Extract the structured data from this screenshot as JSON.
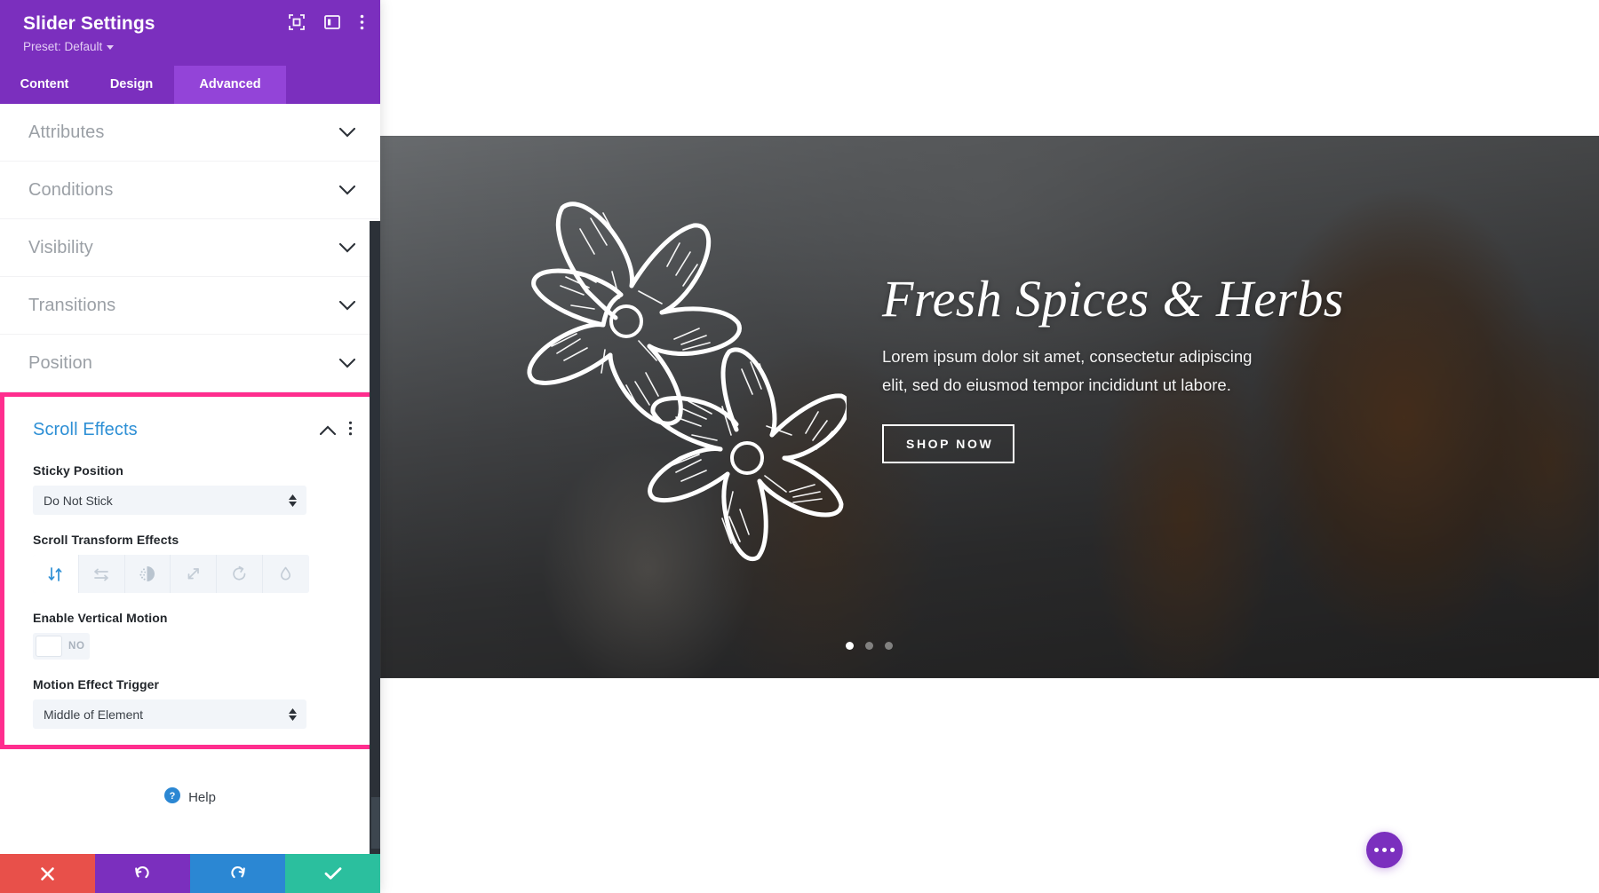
{
  "panel": {
    "title": "Slider Settings",
    "preset": "Preset: Default",
    "header_icons": [
      {
        "name": "focus-frame-icon"
      },
      {
        "name": "panel-layout-icon"
      },
      {
        "name": "more-vertical-icon"
      }
    ],
    "tabs": [
      {
        "label": "Content",
        "active": false
      },
      {
        "label": "Design",
        "active": false
      },
      {
        "label": "Advanced",
        "active": true
      }
    ],
    "accordions": [
      {
        "label": "Attributes"
      },
      {
        "label": "Conditions"
      },
      {
        "label": "Visibility"
      },
      {
        "label": "Transitions"
      },
      {
        "label": "Position"
      }
    ],
    "scroll_effects": {
      "title": "Scroll Effects",
      "expanded": true,
      "highlight_color": "#ff2d8e",
      "title_color": "#2d8fd5",
      "sticky_position": {
        "label": "Sticky Position",
        "value": "Do Not Stick"
      },
      "transform_effects": {
        "label": "Scroll Transform Effects",
        "options": [
          {
            "name": "vertical-motion-icon",
            "active": true
          },
          {
            "name": "horizontal-motion-icon",
            "active": false
          },
          {
            "name": "fade-in-out-icon",
            "active": false
          },
          {
            "name": "scaling-up-down-icon",
            "active": false
          },
          {
            "name": "rotating-icon",
            "active": false
          },
          {
            "name": "blur-icon",
            "active": false
          }
        ]
      },
      "enable_vertical_motion": {
        "label": "Enable Vertical Motion",
        "value": "NO"
      },
      "motion_effect_trigger": {
        "label": "Motion Effect Trigger",
        "value": "Middle of Element"
      }
    },
    "help": {
      "label": "Help"
    },
    "actions": [
      {
        "name": "cancel-button",
        "icon": "close-icon",
        "color": "#e8504a"
      },
      {
        "name": "undo-button",
        "icon": "undo-icon",
        "color": "#7b2fbe"
      },
      {
        "name": "redo-button",
        "icon": "redo-icon",
        "color": "#2b87d3"
      },
      {
        "name": "save-button",
        "icon": "check-icon",
        "color": "#2bbf9e"
      }
    ]
  },
  "preview": {
    "slide": {
      "title": "Fresh Spices & Herbs",
      "description": "Lorem ipsum dolor sit amet, consectetur adipiscing elit, sed do eiusmod tempor incididunt ut labore.",
      "button_label": "SHOP NOW",
      "dots": [
        {
          "active": true
        },
        {
          "active": false
        },
        {
          "active": false
        }
      ]
    },
    "fab": {
      "name": "page-settings-fab"
    }
  }
}
